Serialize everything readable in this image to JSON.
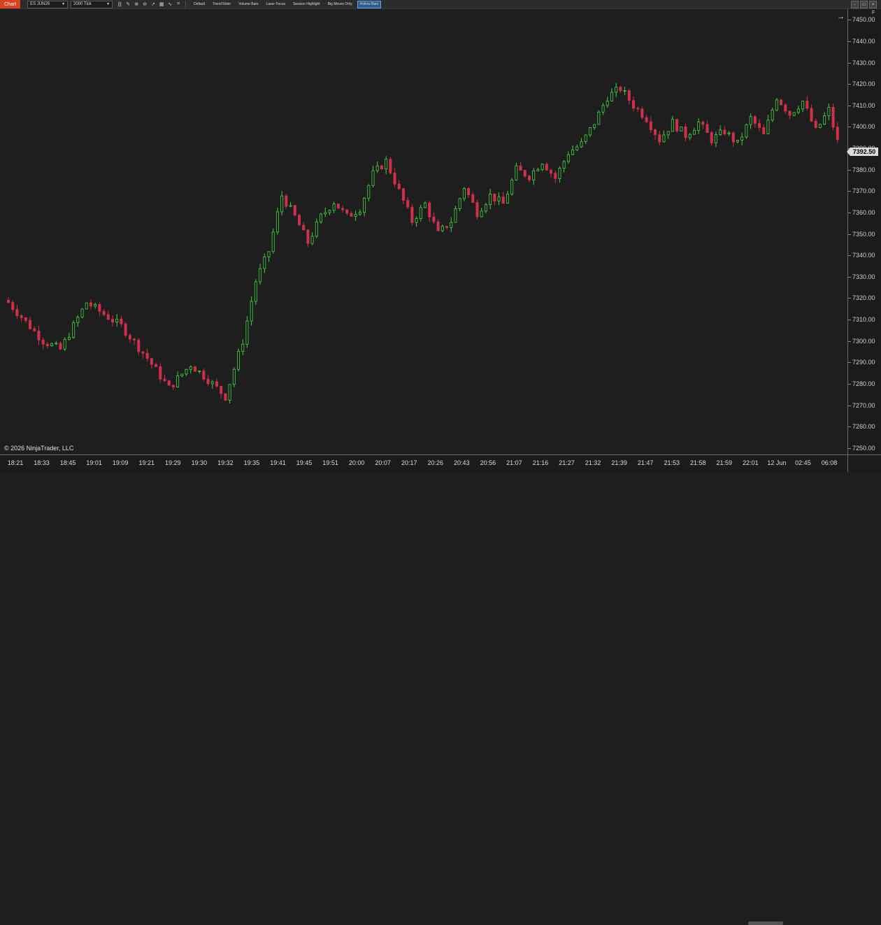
{
  "toolbar": {
    "tab_label": "Chart",
    "instrument": "ES JUN26",
    "interval": "2000 Tick",
    "tools": [
      {
        "name": "bar-type-icon",
        "glyph": "|||"
      },
      {
        "name": "draw-tool-icon",
        "glyph": "✎"
      },
      {
        "name": "zoom-in-icon",
        "glyph": "⊕"
      },
      {
        "name": "zoom-out-icon",
        "glyph": "⊖"
      },
      {
        "name": "cursor-icon",
        "glyph": "➚"
      },
      {
        "name": "properties-icon",
        "glyph": "▦"
      },
      {
        "name": "indicator-icon",
        "glyph": "∿"
      },
      {
        "name": "strategy-icon",
        "glyph": "⌗"
      }
    ],
    "buttons": [
      "Default",
      "Trend Rider",
      "Volume Bars",
      "Laser Focus",
      "Session Highlight",
      "Big Moves Only",
      "Hollow Bars"
    ],
    "active_button": "Hollow Bars"
  },
  "window_controls": [
    "-",
    "□",
    "×"
  ],
  "chart_data": {
    "type": "candlestick",
    "instrument": "ES JUN26",
    "interval": "2000 Tick",
    "y_ticks": [
      "7250.00",
      "7260.00",
      "7270.00",
      "7280.00",
      "7290.00",
      "7300.00",
      "7310.00",
      "7320.00",
      "7330.00",
      "7340.00",
      "7350.00",
      "7360.00",
      "7370.00",
      "7380.00",
      "7390.00",
      "7400.00",
      "7410.00",
      "7420.00",
      "7430.00",
      "7440.00",
      "7450.00"
    ],
    "ylim": [
      7247,
      7455
    ],
    "x_ticks": [
      "18:21",
      "18:33",
      "18:45",
      "19:01",
      "19:09",
      "19:21",
      "19:29",
      "19:30",
      "19:32",
      "19:35",
      "19:41",
      "19:45",
      "19:51",
      "20:00",
      "20:07",
      "20:17",
      "20:26",
      "20:43",
      "20:56",
      "21:07",
      "21:16",
      "21:27",
      "21:32",
      "21:39",
      "21:47",
      "21:53",
      "21:58",
      "21:59",
      "22:01",
      "12 Jun",
      "02:45",
      "06:08"
    ],
    "last_price": "7392.50",
    "up_color": "#3fd13f",
    "down_color": "#d0304a",
    "close_path": [
      [
        0,
        7318
      ],
      [
        8,
        7300
      ],
      [
        12,
        7296
      ],
      [
        18,
        7318
      ],
      [
        26,
        7307
      ],
      [
        32,
        7292
      ],
      [
        37,
        7278
      ],
      [
        42,
        7289
      ],
      [
        46,
        7282
      ],
      [
        50,
        7274
      ],
      [
        54,
        7300
      ],
      [
        57,
        7328
      ],
      [
        60,
        7342
      ],
      [
        63,
        7368
      ],
      [
        66,
        7358
      ],
      [
        69,
        7346
      ],
      [
        72,
        7358
      ],
      [
        75,
        7365
      ],
      [
        78,
        7358
      ],
      [
        81,
        7362
      ],
      [
        84,
        7378
      ],
      [
        87,
        7384
      ],
      [
        90,
        7370
      ],
      [
        93,
        7356
      ],
      [
        96,
        7364
      ],
      [
        99,
        7350
      ],
      [
        102,
        7356
      ],
      [
        105,
        7372
      ],
      [
        108,
        7360
      ],
      [
        111,
        7368
      ],
      [
        114,
        7364
      ],
      [
        117,
        7380
      ],
      [
        120,
        7377
      ],
      [
        123,
        7384
      ],
      [
        126,
        7376
      ],
      [
        129,
        7388
      ],
      [
        132,
        7392
      ],
      [
        135,
        7402
      ],
      [
        138,
        7414
      ],
      [
        141,
        7418
      ],
      [
        144,
        7410
      ],
      [
        147,
        7404
      ],
      [
        150,
        7394
      ],
      [
        153,
        7402
      ],
      [
        156,
        7396
      ],
      [
        159,
        7402
      ],
      [
        162,
        7394
      ],
      [
        165,
        7398
      ],
      [
        168,
        7392
      ],
      [
        171,
        7404
      ],
      [
        174,
        7396
      ],
      [
        177,
        7414
      ],
      [
        180,
        7406
      ],
      [
        183,
        7412
      ],
      [
        186,
        7398
      ],
      [
        189,
        7408
      ],
      [
        191,
        7393
      ]
    ]
  },
  "price_axis": {
    "last_price_label": "7392.50",
    "f_label": "F"
  },
  "footer": {
    "copyright": "© 2026 NinjaTrader, LLC"
  },
  "scroll_arrow": "→"
}
